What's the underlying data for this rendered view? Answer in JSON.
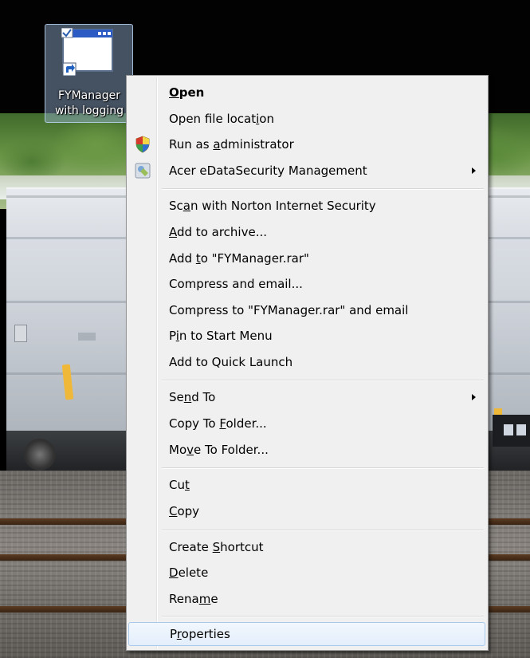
{
  "desktop_icon": {
    "label_line1": "FYManager",
    "label_line2": "with logging"
  },
  "context_menu": {
    "items": [
      {
        "label": "Open",
        "mnemonic": "O",
        "bold": true
      },
      {
        "label": "Open file location",
        "mnemonic": "i"
      },
      {
        "label": "Run as administrator",
        "mnemonic": "a",
        "icon": "uac-shield-icon"
      },
      {
        "label": "Acer eDataSecurity Management",
        "submenu": true,
        "icon": "acer-edatasecurity-icon"
      },
      {
        "label": "Scan with Norton Internet Security",
        "mnemonic": "a"
      },
      {
        "label": "Add to archive...",
        "mnemonic": "A"
      },
      {
        "label": "Add to \"FYManager.rar\"",
        "mnemonic": "t"
      },
      {
        "label": "Compress and email..."
      },
      {
        "label": "Compress to \"FYManager.rar\" and email"
      },
      {
        "label": "Pin to Start Menu",
        "mnemonic": "i"
      },
      {
        "label": "Add to Quick Launch"
      },
      {
        "label": "Send To",
        "mnemonic": "n",
        "submenu": true
      },
      {
        "label": "Copy To Folder...",
        "mnemonic": "F"
      },
      {
        "label": "Move To Folder...",
        "mnemonic": "v"
      },
      {
        "label": "Cut",
        "mnemonic": "t"
      },
      {
        "label": "Copy",
        "mnemonic": "C"
      },
      {
        "label": "Create Shortcut",
        "mnemonic": "S"
      },
      {
        "label": "Delete",
        "mnemonic": "D"
      },
      {
        "label": "Rename",
        "mnemonic": "m"
      },
      {
        "label": "Properties",
        "mnemonic": "r",
        "highlighted": true
      }
    ]
  },
  "colors": {
    "menu_background": "#f0f0f0",
    "menu_border": "#979797",
    "hover_border": "#a8c8ec",
    "desktop_icon_selection": "#96b4d7"
  }
}
